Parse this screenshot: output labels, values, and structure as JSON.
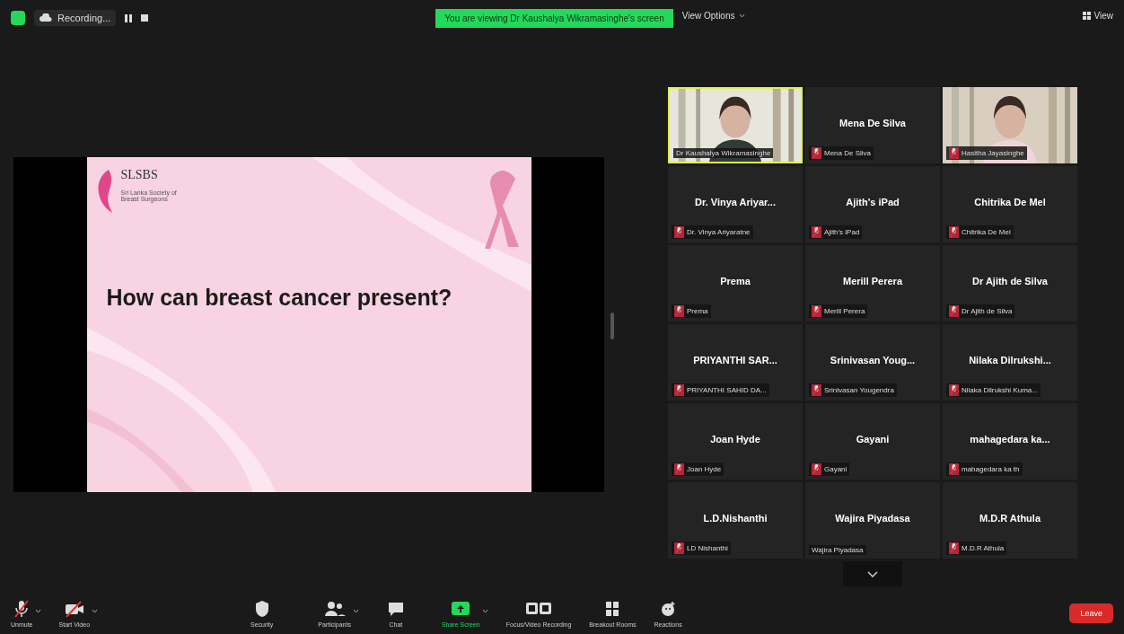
{
  "top_bar": {
    "recording": "Recording...",
    "banner": "You are viewing Dr Kaushalya Wikramasinghe's screen",
    "view_options": "View Options",
    "view": "View"
  },
  "slide": {
    "logo_text": "SLSBS",
    "logo_subtitle_1": "Sri Lanka Society of",
    "logo_subtitle_2": "Breast Surgeons",
    "heading": "How can breast cancer present?"
  },
  "tiles": [
    {
      "kind": "video",
      "label": "Dr Kaushalya Wikramasinghe",
      "muted": false,
      "selected": true
    },
    {
      "kind": "name",
      "name": "Mena De Silva",
      "label": "Mena De Silva",
      "muted": true,
      "selected": false
    },
    {
      "kind": "video",
      "label": "Hasitha Jayasinghe",
      "muted": true,
      "selected": false
    },
    {
      "kind": "name",
      "name": "Dr. Vinya Ariyar...",
      "label": "Dr. Vinya Ariyaratne",
      "muted": true,
      "selected": false
    },
    {
      "kind": "name",
      "name": "Ajith's iPad",
      "label": "Ajith's iPad",
      "muted": true,
      "selected": false
    },
    {
      "kind": "name",
      "name": "Chitrika De Mel",
      "label": "Chitrika De Mel",
      "muted": true,
      "selected": false
    },
    {
      "kind": "name",
      "name": "Prema",
      "label": "Prema",
      "muted": true,
      "selected": false
    },
    {
      "kind": "name",
      "name": "Merill Perera",
      "label": "Merill Perera",
      "muted": true,
      "selected": false
    },
    {
      "kind": "name",
      "name": "Dr Ajith de Silva",
      "label": "Dr Ajith de Silva",
      "muted": true,
      "selected": false
    },
    {
      "kind": "name",
      "name": "PRIYANTHI SAR...",
      "label": "PRIYANTHI SAHID DA...",
      "muted": true,
      "selected": false
    },
    {
      "kind": "name",
      "name": "Srinivasan Youg...",
      "label": "Srinivasan Yougendra",
      "muted": true,
      "selected": false
    },
    {
      "kind": "name",
      "name": "Nilaka Dilrukshi...",
      "label": "Nilaka Dilrukshi Kuma...",
      "muted": true,
      "selected": false
    },
    {
      "kind": "name",
      "name": "Joan Hyde",
      "label": "Joan Hyde",
      "muted": true,
      "selected": false
    },
    {
      "kind": "name",
      "name": "Gayani",
      "label": "Gayani",
      "muted": true,
      "selected": false
    },
    {
      "kind": "name",
      "name": "mahagedara ka...",
      "label": "mahagedara ka th",
      "muted": true,
      "selected": false
    },
    {
      "kind": "name",
      "name": "L.D.Nishanthi",
      "label": "LD Nishanthi",
      "muted": true,
      "selected": false
    },
    {
      "kind": "name",
      "name": "Wajira Piyadasa",
      "label": "Wajira Piyadasa",
      "muted": false,
      "selected": false
    },
    {
      "kind": "name",
      "name": "M.D.R Athula",
      "label": "M.D.R Athula",
      "muted": true,
      "selected": false
    }
  ],
  "toolbar": [
    {
      "kind": "mic",
      "label": "Unmute",
      "caret": true
    },
    {
      "kind": "video",
      "label": "Start Video",
      "caret": true
    },
    {
      "kind": "security",
      "label": "Security",
      "caret": false
    },
    {
      "kind": "participants",
      "label": "Participants",
      "caret": true
    },
    {
      "kind": "chat",
      "label": "Chat",
      "caret": false
    },
    {
      "kind": "share",
      "label": "Share Screen",
      "caret": true
    },
    {
      "kind": "caption",
      "label": "Focus/Video Recording",
      "caret": false
    },
    {
      "kind": "breakout",
      "label": "Breakout Rooms",
      "caret": false
    },
    {
      "kind": "reactions",
      "label": "Reactions",
      "caret": false
    }
  ],
  "leave": "Leave"
}
